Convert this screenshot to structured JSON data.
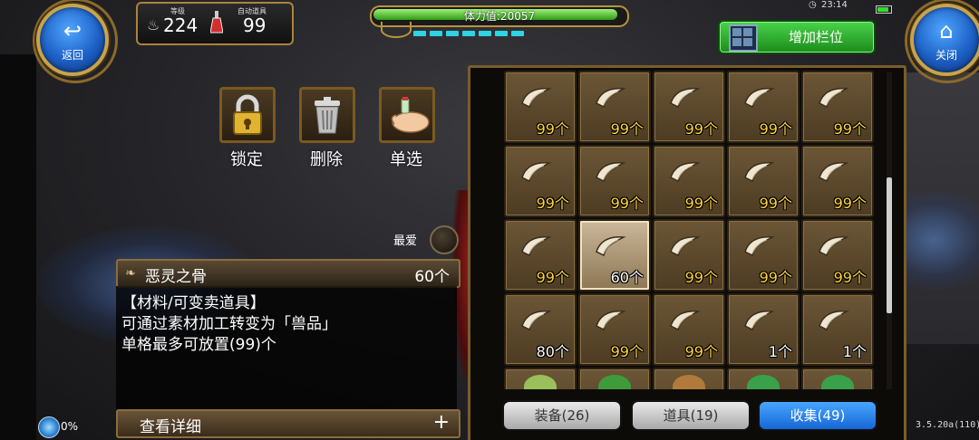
{
  "top": {
    "back_label": "返回",
    "close_label": "关闭",
    "level_label": "等级",
    "level_value": "224",
    "auto_item_label": "自动道具",
    "auto_item_value": "99",
    "stamina_text": "体力值:20057",
    "stamina_fraction": 0.98,
    "stamina_pips": 7,
    "clock": "23:14",
    "add_slot_label": "增加栏位"
  },
  "actions": {
    "lock": "锁定",
    "delete": "删除",
    "single_select": "单选"
  },
  "favorite_label": "最爱",
  "item": {
    "name": "恶灵之骨",
    "count": "60个",
    "desc_1": "【材料/可变卖道具】",
    "desc_2": "可通过素材加工转变为「兽品」",
    "desc_3": "单格最多可放置(99)个",
    "detail_label": "查看详细",
    "detail_plus": "+"
  },
  "progress_text": "0%",
  "inventory": {
    "rows": [
      [
        "99个",
        "99个",
        "99个",
        "99个",
        "99个"
      ],
      [
        "99个",
        "99个",
        "99个",
        "99个",
        "99个"
      ],
      [
        "99个",
        "60个",
        "99个",
        "99个",
        "99个"
      ],
      [
        "80个",
        "99个",
        "99个",
        "1个",
        "1个"
      ]
    ],
    "selected_row": 2,
    "selected_col": 1
  },
  "tabs": [
    {
      "label": "装备(26)",
      "active": false
    },
    {
      "label": "道具(19)",
      "active": false
    },
    {
      "label": "收集(49)",
      "active": true
    }
  ],
  "version": "3.5.20a(110)",
  "colors": {
    "qty_yellow": "#ffd43b",
    "tab_active": "#1566d6",
    "add_slot_green": "#1b8b1b",
    "stamina_green": "#2f9b16"
  }
}
